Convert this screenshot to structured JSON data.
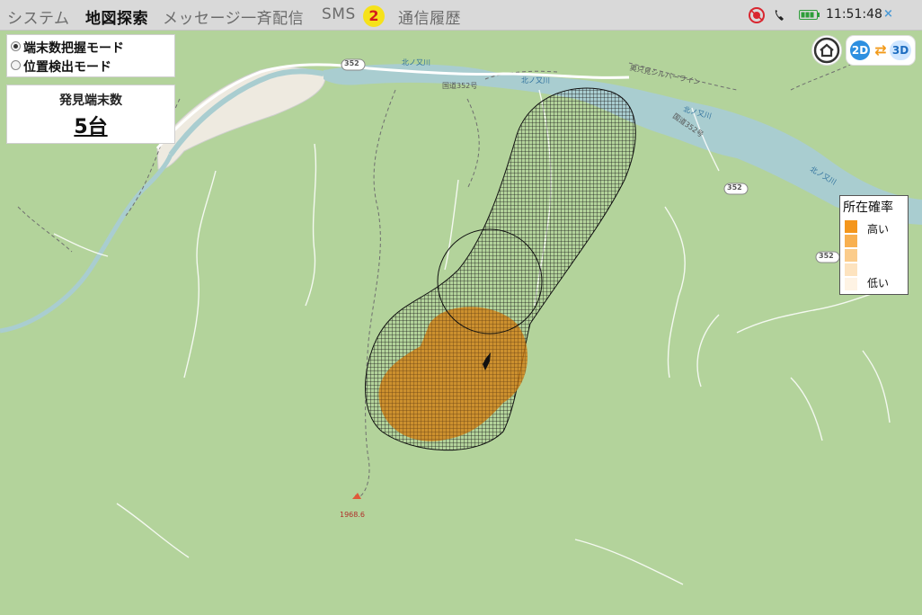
{
  "topbar": {
    "menu": [
      {
        "label": "システム",
        "active": false
      },
      {
        "label": "地図探索",
        "active": true
      },
      {
        "label": "メッセージ一斉配信",
        "active": false
      },
      {
        "label": "SMS",
        "active": false
      },
      {
        "label": "通信履歴",
        "active": false
      }
    ],
    "sms_badge": "2",
    "clock": "11:51:48",
    "close_label": "×"
  },
  "mode_panel": {
    "options": [
      {
        "label": "端末数把握モード",
        "selected": true
      },
      {
        "label": "位置検出モード",
        "selected": false
      }
    ]
  },
  "count_panel": {
    "title": "発見端末数",
    "value": "5台"
  },
  "view_toggle": {
    "label_2d": "2D",
    "label_3d": "3D"
  },
  "legend": {
    "title": "所在確率",
    "high": "高い",
    "low": "低い",
    "colors": [
      "#f4961c",
      "#f8b050",
      "#fbcc8b",
      "#fde3bf",
      "#fef3e4"
    ]
  },
  "map": {
    "route_badges": [
      "352",
      "352",
      "352"
    ],
    "road_labels": [
      "国道352号",
      "国道352号",
      "奥只見シルバーライン"
    ],
    "river_labels": [
      "北ノ又川",
      "北ノ又川",
      "北ノ又川",
      "北ノ又川"
    ],
    "peak_label": "1968.6",
    "colors": {
      "land": "#b3d39b",
      "water": "#a9cdd0",
      "cleared": "#eeeae0",
      "probability": "#d47d10"
    }
  }
}
